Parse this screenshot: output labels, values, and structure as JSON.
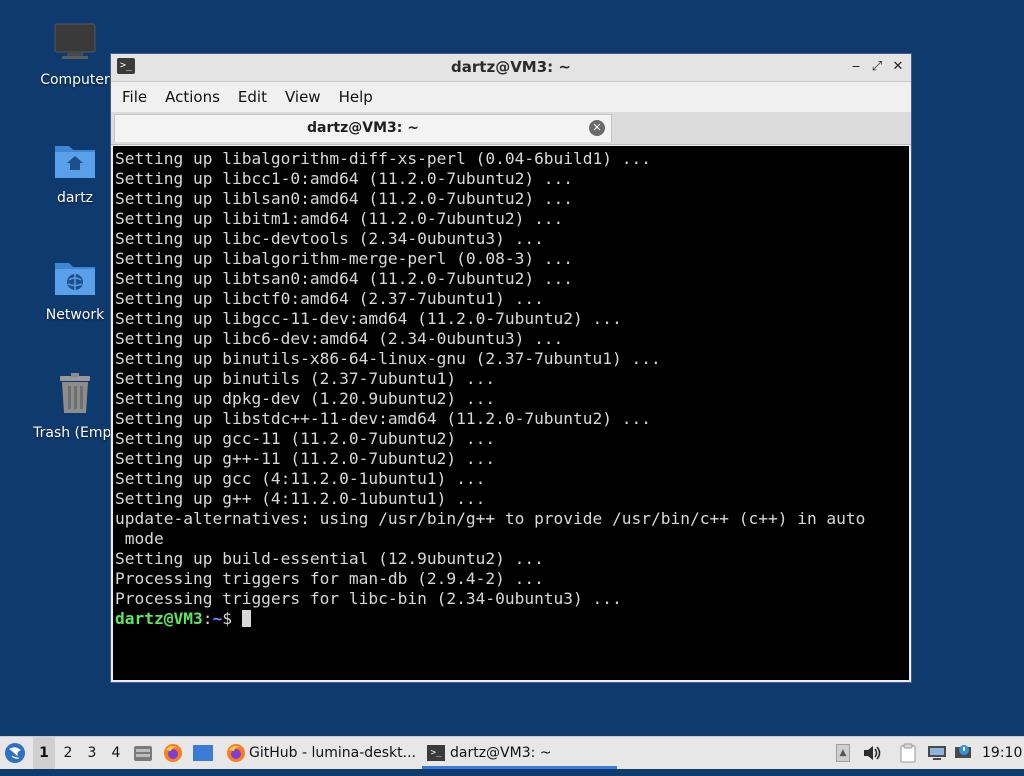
{
  "desktop": {
    "icons": [
      {
        "label": "Computer"
      },
      {
        "label": "dartz"
      },
      {
        "label": "Network"
      },
      {
        "label": "Trash (Empt"
      }
    ]
  },
  "window": {
    "title": "dartz@VM3: ~",
    "menus": [
      "File",
      "Actions",
      "Edit",
      "View",
      "Help"
    ],
    "tab_label": "dartz@VM3: ~",
    "controls": {
      "minimize": "‒",
      "maximize": "⤢",
      "close": "✕"
    }
  },
  "terminal": {
    "lines": [
      "Setting up libalgorithm-diff-xs-perl (0.04-6build1) ...",
      "Setting up libcc1-0:amd64 (11.2.0-7ubuntu2) ...",
      "Setting up liblsan0:amd64 (11.2.0-7ubuntu2) ...",
      "Setting up libitm1:amd64 (11.2.0-7ubuntu2) ...",
      "Setting up libc-devtools (2.34-0ubuntu3) ...",
      "Setting up libalgorithm-merge-perl (0.08-3) ...",
      "Setting up libtsan0:amd64 (11.2.0-7ubuntu2) ...",
      "Setting up libctf0:amd64 (2.37-7ubuntu1) ...",
      "Setting up libgcc-11-dev:amd64 (11.2.0-7ubuntu2) ...",
      "Setting up libc6-dev:amd64 (2.34-0ubuntu3) ...",
      "Setting up binutils-x86-64-linux-gnu (2.37-7ubuntu1) ...",
      "Setting up binutils (2.37-7ubuntu1) ...",
      "Setting up dpkg-dev (1.20.9ubuntu2) ...",
      "Setting up libstdc++-11-dev:amd64 (11.2.0-7ubuntu2) ...",
      "Setting up gcc-11 (11.2.0-7ubuntu2) ...",
      "Setting up g++-11 (11.2.0-7ubuntu2) ...",
      "Setting up gcc (4:11.2.0-1ubuntu1) ...",
      "Setting up g++ (4:11.2.0-1ubuntu1) ...",
      "update-alternatives: using /usr/bin/g++ to provide /usr/bin/c++ (c++) in auto",
      " mode",
      "Setting up build-essential (12.9ubuntu2) ...",
      "Processing triggers for man-db (2.9.4-2) ...",
      "Processing triggers for libc-bin (2.34-0ubuntu3) ..."
    ],
    "prompt": {
      "user_host": "dartz@VM3",
      "sep": ":",
      "path": "~",
      "symbol": "$ "
    }
  },
  "taskbar": {
    "workspaces": [
      "1",
      "2",
      "3",
      "4"
    ],
    "active_workspace": "1",
    "tasks": [
      {
        "label": "GitHub - lumina-deskt...",
        "icon": "firefox-icon"
      },
      {
        "label": "dartz@VM3: ~",
        "icon": "terminal-icon"
      }
    ],
    "clock": "19:10"
  },
  "colors": {
    "desktop_bg": "#0f3a6e",
    "prompt_user": "#5fe55f",
    "prompt_path": "#6e8cff"
  }
}
